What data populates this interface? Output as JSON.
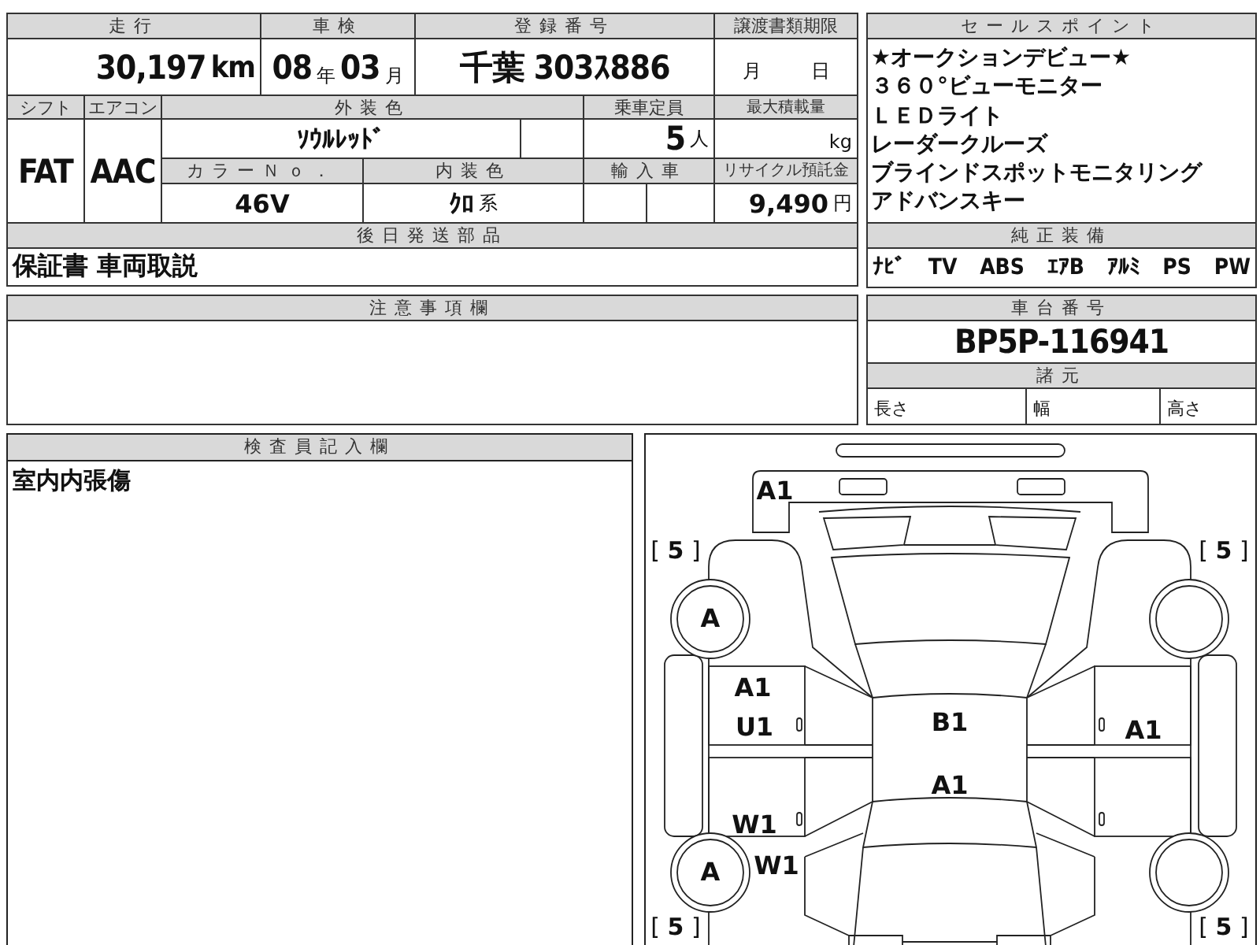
{
  "top_table": {
    "mileage": {
      "label": "走行",
      "value": "30,197",
      "unit": "km"
    },
    "inspection": {
      "label": "車検",
      "year": "08",
      "year_unit": "年",
      "month": "03",
      "month_unit": "月"
    },
    "registration": {
      "label": "登録番号",
      "value": "千葉 303ｽ886"
    },
    "transfer_deadline": {
      "label": "譲渡書類期限",
      "month_unit": "月",
      "day_unit": "日"
    },
    "shift": {
      "label": "シフト",
      "value": "FAT"
    },
    "air_conditioner": {
      "label": "エアコン",
      "value": "AAC"
    },
    "exterior_color": {
      "label": "外装色",
      "value": "ｿｳﾙﾚｯﾄﾞ"
    },
    "capacity": {
      "label": "乗車定員",
      "value": "5",
      "unit": "人"
    },
    "max_load": {
      "label": "最大積載量",
      "unit": "kg"
    },
    "color_no": {
      "label": "カラーＮｏ．",
      "value": "46V"
    },
    "interior_color": {
      "label": "内装色",
      "value": "ｸﾛ",
      "suffix": "系"
    },
    "import": {
      "label": "輸入車"
    },
    "recycle_deposit": {
      "label": "リサイクル預託金",
      "value": "9,490",
      "unit": "円"
    },
    "parts_to_follow": {
      "label": "後日発送部品",
      "value": "保証書 車両取説"
    }
  },
  "sales_points": {
    "label": "セールスポイント",
    "items": [
      "★オークションデビュー★",
      "３６０°ビューモニター",
      "ＬＥＤライト",
      "レーダークルーズ",
      "ブラインドスポットモニタリング",
      "アドバンスキー"
    ]
  },
  "equipment": {
    "label": "純正装備",
    "items": [
      "ﾅﾋﾞ",
      "TV",
      "ABS",
      "ｴｱB",
      "ｱﾙﾐ",
      "PS",
      "PW"
    ]
  },
  "notes": {
    "label": "注意事項欄"
  },
  "chassis": {
    "label": "車台番号",
    "value": "BP5P-116941"
  },
  "specs": {
    "label": "諸元",
    "items": [
      "長さ",
      "幅",
      "高さ"
    ]
  },
  "inspector": {
    "label": "検査員記入欄",
    "text": "室内内張傷"
  },
  "diagram": {
    "marks": [
      {
        "code": "A1"
      },
      {
        "code": "A"
      },
      {
        "code": "A"
      },
      {
        "code": "A1"
      },
      {
        "code": "U1"
      },
      {
        "code": "W1"
      },
      {
        "code": "W1"
      },
      {
        "code": "B1"
      },
      {
        "code": "A1"
      },
      {
        "code": "A1"
      }
    ],
    "tread": [
      {
        "text": "[ **5** ]"
      },
      {
        "text": "[ **5** ]"
      },
      {
        "text": "[ **5** ]"
      },
      {
        "text": "[ **5** ]"
      }
    ]
  }
}
